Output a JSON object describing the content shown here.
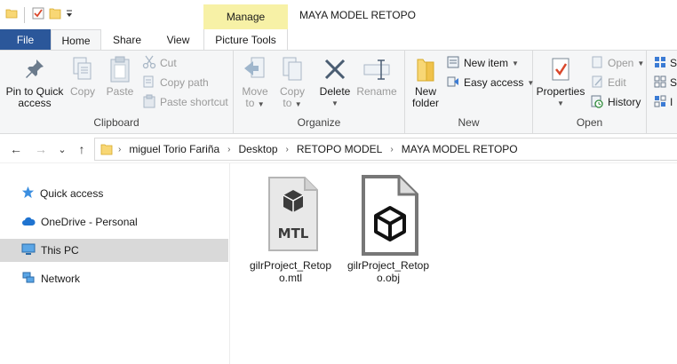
{
  "window": {
    "title": "MAYA MODEL RETOPO",
    "context_tab_group": "Manage"
  },
  "qat": {
    "icons": [
      "folder-icon",
      "properties-check-icon",
      "new-folder-icon",
      "customize-qat-icon"
    ],
    "dropdown_glyph": "▾"
  },
  "tabs": {
    "file": "File",
    "home": "Home",
    "share": "Share",
    "view": "View",
    "picture_tools": "Picture Tools"
  },
  "ribbon": {
    "clipboard": {
      "label": "Clipboard",
      "pin_line1": "Pin to Quick",
      "pin_line2": "access",
      "copy": "Copy",
      "paste": "Paste",
      "cut": "Cut",
      "copy_path": "Copy path",
      "paste_shortcut": "Paste shortcut"
    },
    "organize": {
      "label": "Organize",
      "move_line1": "Move",
      "move_line2": "to",
      "copy_line1": "Copy",
      "copy_line2": "to",
      "delete": "Delete",
      "rename": "Rename"
    },
    "new": {
      "label": "New",
      "new_folder_line1": "New",
      "new_folder_line2": "folder",
      "new_item": "New item",
      "easy_access": "Easy access"
    },
    "open": {
      "label": "Open",
      "properties": "Properties",
      "open": "Open",
      "edit": "Edit",
      "history": "History"
    },
    "select": {
      "partial_s": "S",
      "partial_s2": "S",
      "partial_i": "I"
    }
  },
  "nav": {
    "back": "←",
    "forward": "→",
    "recent": "⌄",
    "up": "↑",
    "breadcrumb": [
      "miguel Torio Fariña",
      "Desktop",
      "RETOPO MODEL",
      "MAYA MODEL RETOPO"
    ],
    "separator": "›"
  },
  "navpane": {
    "items": [
      {
        "label": "Quick access",
        "icon": "star-icon"
      },
      {
        "label": "OneDrive - Personal",
        "icon": "cloud-icon"
      },
      {
        "label": "This PC",
        "icon": "computer-icon",
        "selected": true
      },
      {
        "label": "Network",
        "icon": "network-icon"
      }
    ]
  },
  "files": [
    {
      "name": "gilrProject_Retopo.mtl",
      "icon": "mtl-file-icon",
      "badge": "MTL"
    },
    {
      "name": "gilrProject_Retopo.obj",
      "icon": "obj-file-icon"
    }
  ],
  "colors": {
    "file_tab": "#2b579a",
    "context_highlight": "#f7f1a6",
    "folder_yellow": "#f8d775",
    "selected_nav": "#d9d9d9"
  }
}
